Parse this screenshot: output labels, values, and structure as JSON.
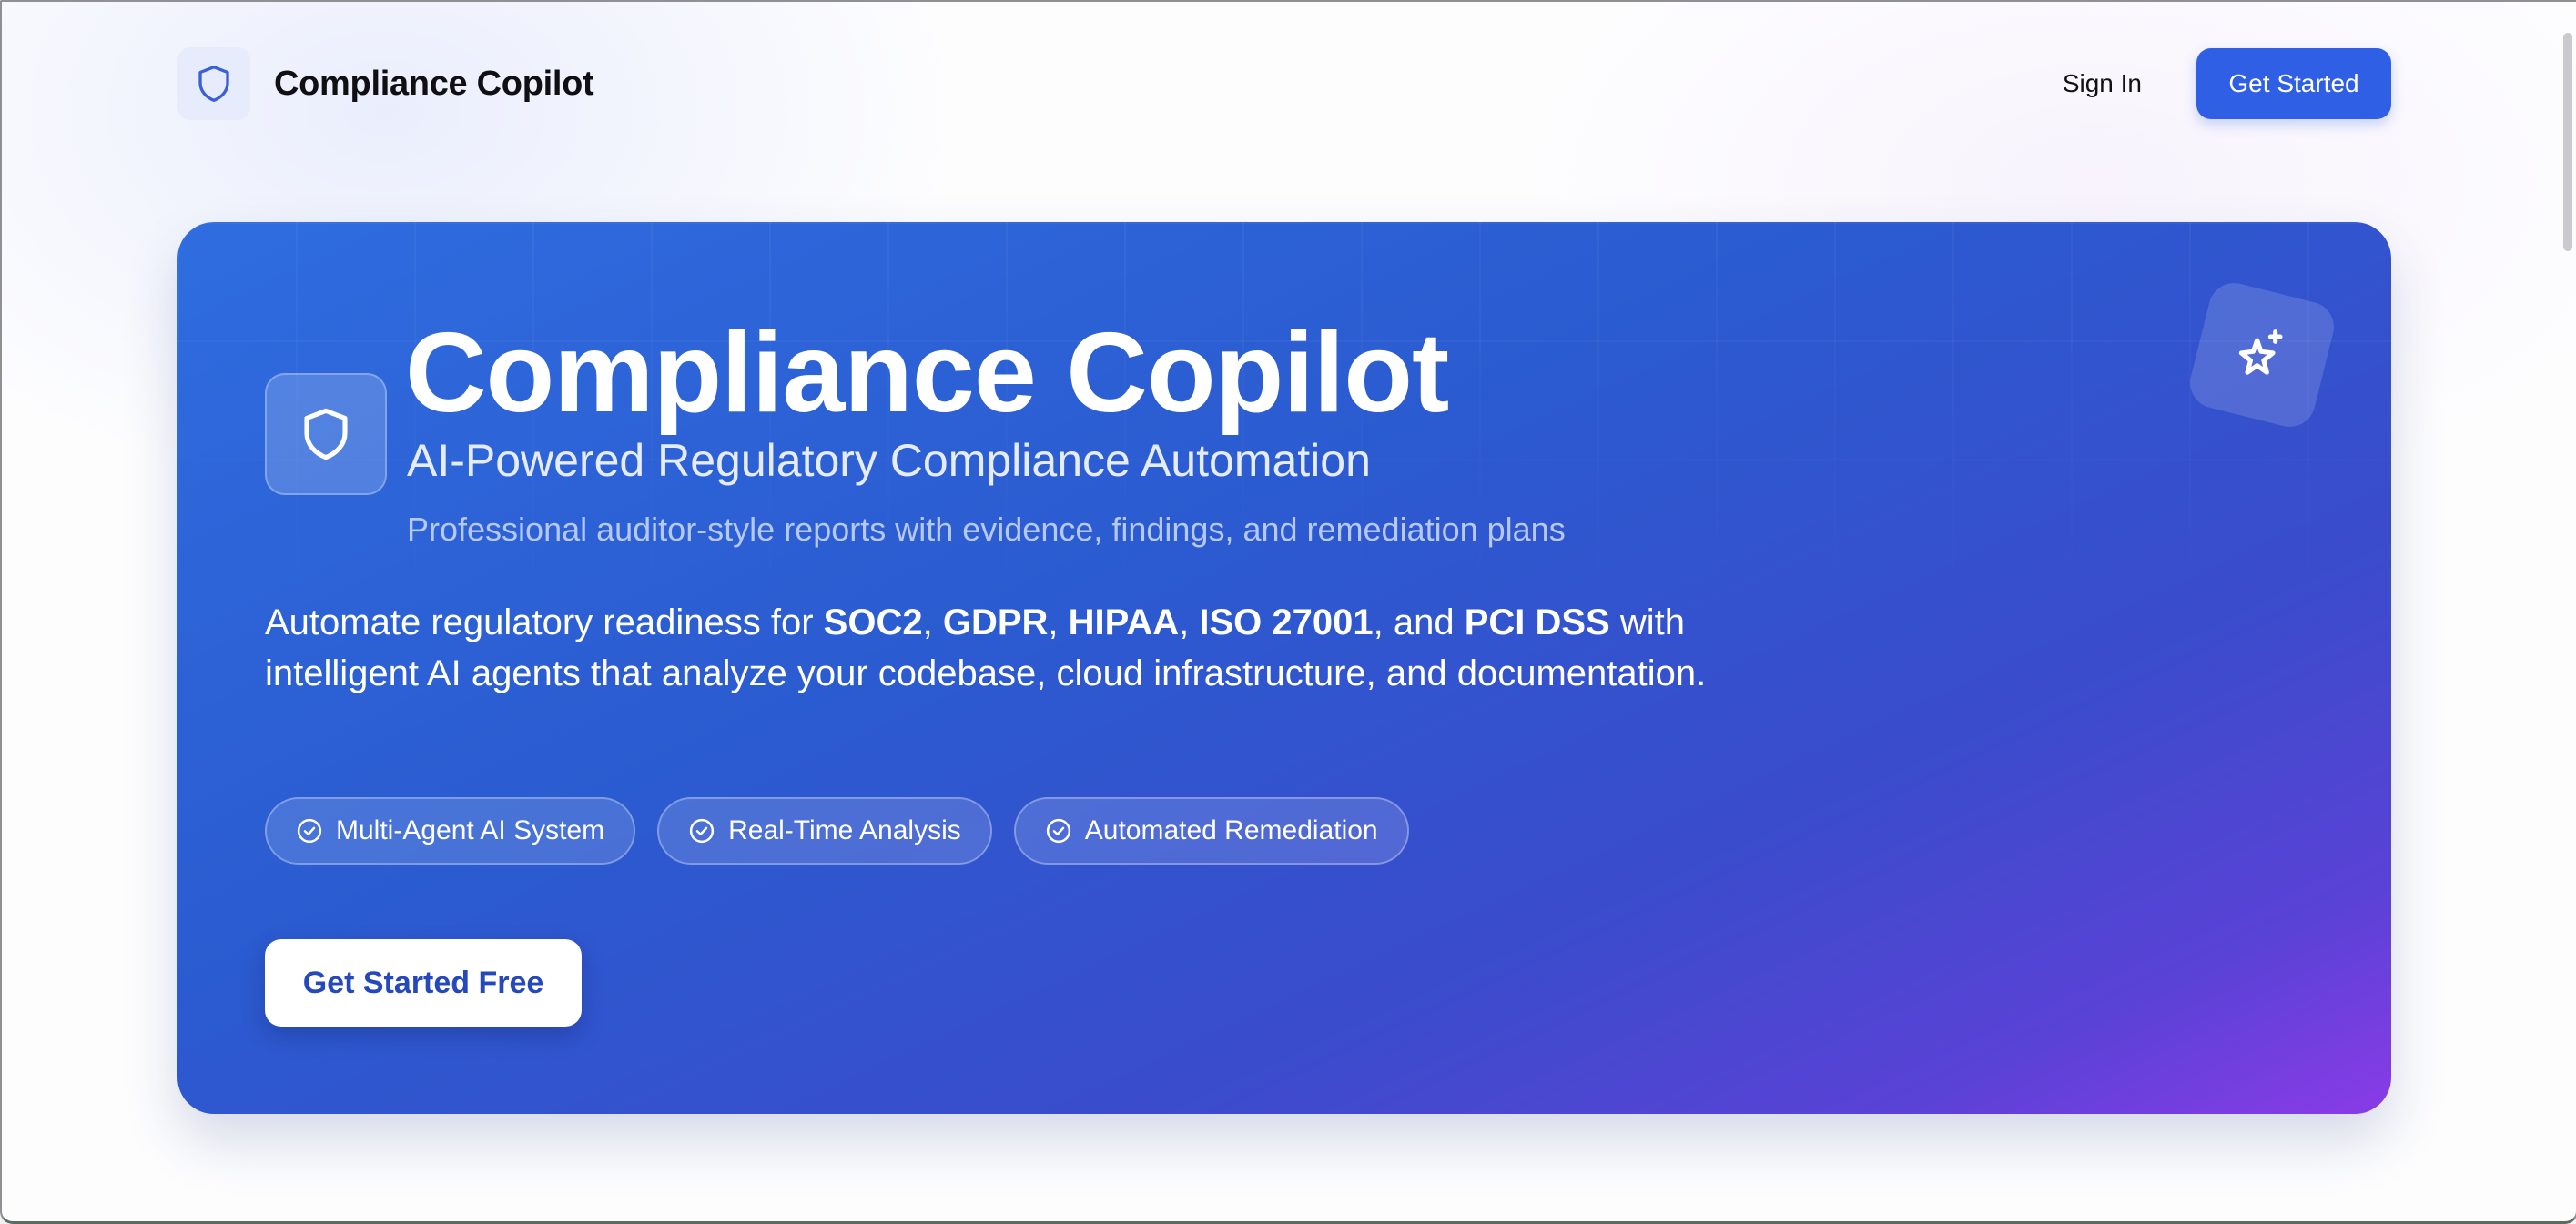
{
  "header": {
    "brand_name": "Compliance Copilot",
    "brand_icon": "shield-icon",
    "sign_in": "Sign In",
    "get_started": "Get Started"
  },
  "hero": {
    "title": "Compliance Copilot",
    "subtitle": "AI-Powered Regulatory Compliance Automation",
    "tagline": "Professional auditor-style reports with evidence, findings, and remediation plans",
    "description": {
      "prefix": "Automate regulatory readiness for ",
      "frameworks": [
        "SOC2",
        "GDPR",
        "HIPAA",
        "ISO 27001",
        "PCI DSS"
      ],
      "separator": ", ",
      "conjunction": ", and ",
      "suffix": " with intelligent AI agents that analyze your codebase, cloud infrastructure, and documentation."
    },
    "badges": [
      {
        "label": "Multi-Agent AI System",
        "icon": "check-circle-icon"
      },
      {
        "label": "Real-Time Analysis",
        "icon": "check-circle-icon"
      },
      {
        "label": "Automated Remediation",
        "icon": "check-circle-icon"
      }
    ],
    "cta": "Get Started Free",
    "decor_icon": "sparkles-icon"
  },
  "colors": {
    "accent": "#2f5fe4",
    "hero_gradient_start": "#2f6de0",
    "hero_gradient_end": "#8a3be6",
    "cta_text": "#2549bd"
  }
}
